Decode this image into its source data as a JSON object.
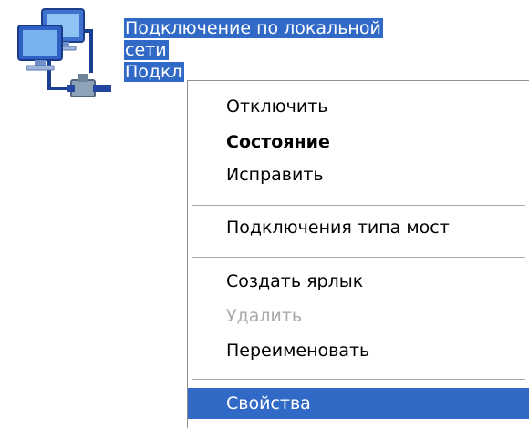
{
  "connection": {
    "name_line1": "Подключение по локальной",
    "name_line2": "сети",
    "status_partial": "Подкл",
    "icon": "network-connection-icon",
    "selected_color": "#3169c6"
  },
  "context_menu": {
    "items": [
      {
        "label": "Отключить",
        "style": "normal"
      },
      {
        "label": "Состояние",
        "style": "default-bold"
      },
      {
        "label": "Исправить",
        "style": "normal"
      },
      {
        "label": "Подключения типа мост",
        "style": "normal"
      },
      {
        "label": "Создать ярлык",
        "style": "normal"
      },
      {
        "label": "Удалить",
        "style": "disabled"
      },
      {
        "label": "Переименовать",
        "style": "normal"
      },
      {
        "label": "Свойства",
        "style": "highlighted"
      }
    ],
    "highlight_color": "#3169c6"
  }
}
